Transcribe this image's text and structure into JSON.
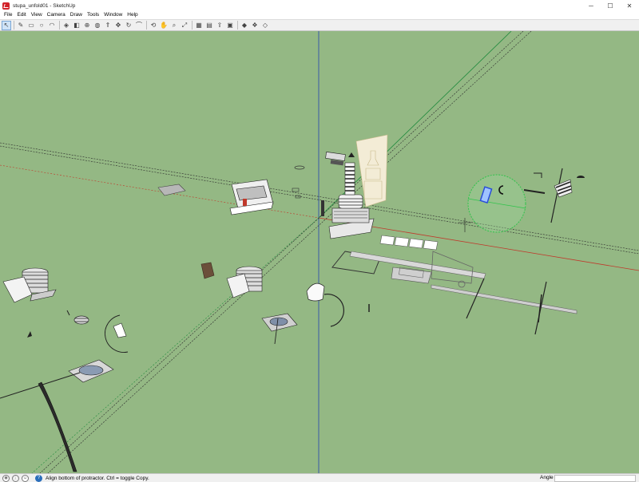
{
  "window": {
    "title": "stupa_unfold01 - SketchUp",
    "min_icon": "minimize-icon",
    "max_icon": "maximize-icon",
    "close_icon": "close-icon"
  },
  "menu": [
    "File",
    "Edit",
    "View",
    "Camera",
    "Draw",
    "Tools",
    "Window",
    "Help"
  ],
  "toolbar": {
    "tools": [
      {
        "name": "select-tool-icon",
        "glyph": "↖",
        "active": true
      },
      {
        "name": "pencil-line-tool-icon",
        "glyph": "✎"
      },
      {
        "name": "rectangle-tool-icon",
        "glyph": "▭"
      },
      {
        "name": "circle-tool-icon",
        "glyph": "○"
      },
      {
        "name": "arc-tool-icon",
        "glyph": "◠"
      },
      {
        "name": "make-component-icon",
        "glyph": "◈"
      },
      {
        "name": "eraser-tool-icon",
        "glyph": "◧"
      },
      {
        "name": "tape-measure-tool-icon",
        "glyph": "⊕"
      },
      {
        "name": "paint-bucket-tool-icon",
        "glyph": "◍"
      },
      {
        "name": "push-pull-tool-icon",
        "glyph": "⇑"
      },
      {
        "name": "move-tool-icon",
        "glyph": "✥"
      },
      {
        "name": "rotate-tool-icon",
        "glyph": "↻"
      },
      {
        "name": "offset-tool-icon",
        "glyph": "⌒"
      },
      {
        "name": "orbit-tool-icon",
        "glyph": "⟲"
      },
      {
        "name": "pan-tool-icon",
        "glyph": "✋"
      },
      {
        "name": "zoom-tool-icon",
        "glyph": "⌕"
      },
      {
        "name": "zoom-extents-icon",
        "glyph": "⤢"
      },
      {
        "name": "3d-warehouse-icon",
        "glyph": "▦"
      },
      {
        "name": "extension-warehouse-icon",
        "glyph": "▤"
      },
      {
        "name": "share-model-icon",
        "glyph": "⇪"
      },
      {
        "name": "layout-icon",
        "glyph": "▣"
      },
      {
        "name": "extension-manager-icon",
        "glyph": "◆"
      },
      {
        "name": "model-info-icon",
        "glyph": "❖"
      },
      {
        "name": "styles-icon",
        "glyph": "◇"
      }
    ]
  },
  "status": {
    "geo_icon": "geolocation-icon",
    "credits_icon": "credits-icon",
    "user_icon": "user-icon",
    "help_icon": "help-icon",
    "help_glyph": "?",
    "message": "Align bottom of protractor.  Ctrl = toggle Copy.",
    "measurement_label": "Angle",
    "measurement_value": ""
  },
  "colors": {
    "background": "#94b884",
    "axis_red": "#c0392b",
    "axis_green": "#1e8a3c",
    "axis_blue": "#3a5aa8",
    "protractor": "#2ec44a",
    "selection_blue": "#2a4fd8"
  }
}
